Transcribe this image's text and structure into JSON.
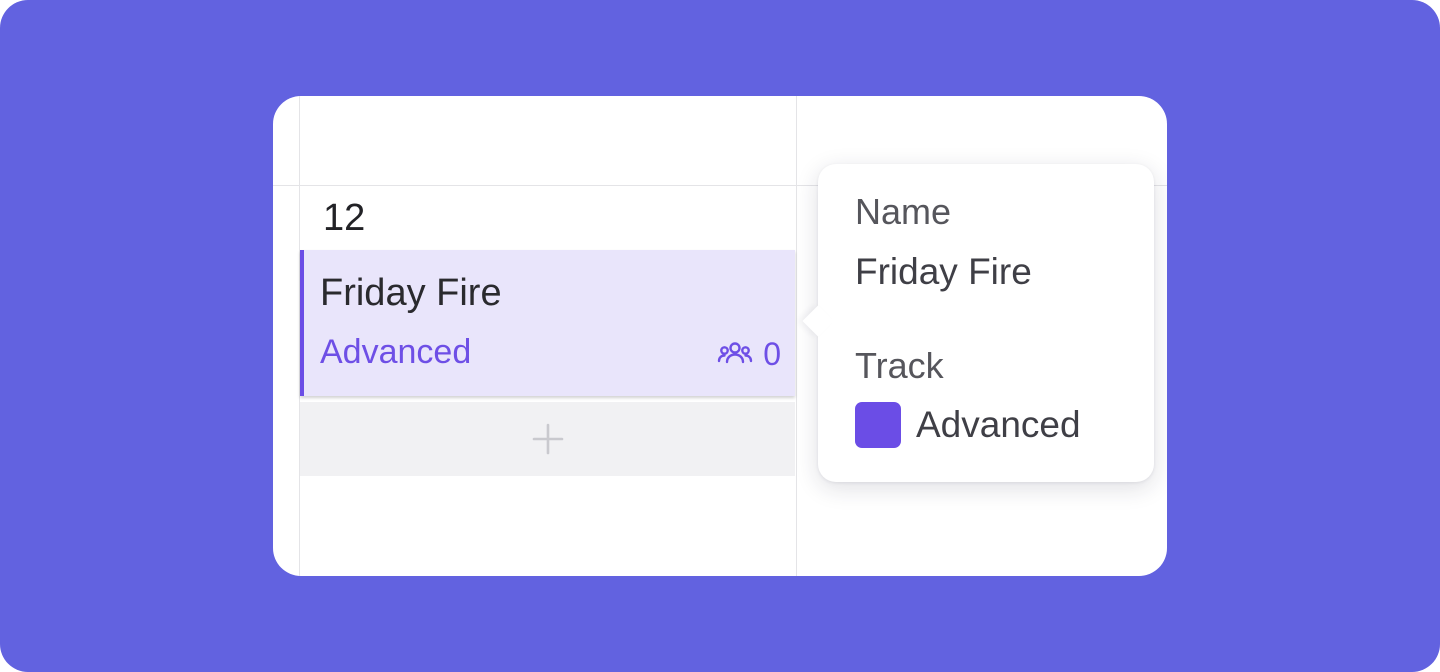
{
  "colors": {
    "background": "#6262e0",
    "accent": "#6b4de6",
    "event_fill": "#e9e5fb"
  },
  "calendar": {
    "day_number": "12"
  },
  "event": {
    "title": "Friday Fire",
    "track": "Advanced",
    "participants_icon": "group-icon",
    "participants_count": "0"
  },
  "add_slot": {
    "icon": "plus-icon"
  },
  "tooltip": {
    "name_label": "Name",
    "name_value": "Friday Fire",
    "track_label": "Track",
    "track_value": "Advanced",
    "track_color": "#6b4de6"
  }
}
